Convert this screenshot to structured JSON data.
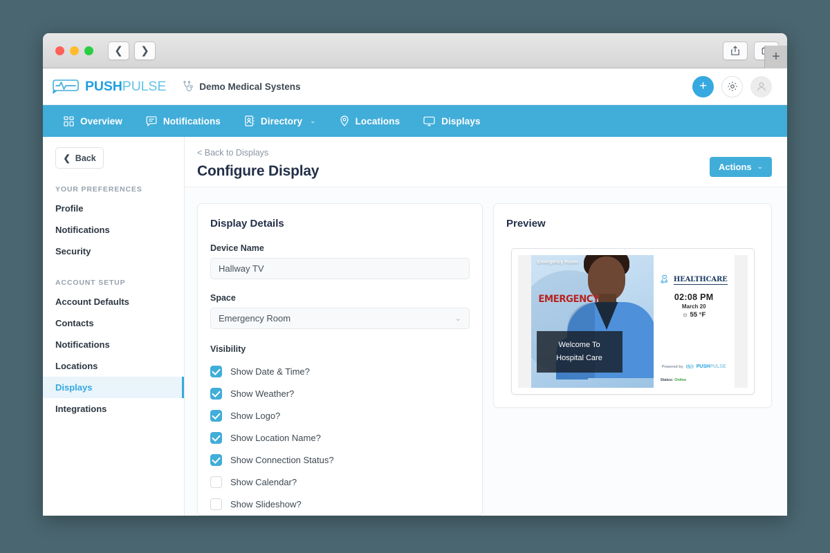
{
  "browser": {
    "back_icon": "chevron-left-icon",
    "forward_icon": "chevron-right-icon",
    "share_icon": "share-icon",
    "tabs_icon": "copy-tabs-icon",
    "new_tab_label": "+"
  },
  "header": {
    "logo_bold": "PUSH",
    "logo_light": "PULSE",
    "org_name": "Demo Medical Systens",
    "add_label": "+",
    "gear_icon": "gear-icon",
    "avatar_icon": "user-avatar-icon"
  },
  "nav": {
    "items": [
      {
        "label": "Overview",
        "icon": "grid-icon",
        "caret": ""
      },
      {
        "label": "Notifications",
        "icon": "chat-bubble-icon",
        "caret": ""
      },
      {
        "label": "Directory",
        "icon": "address-book-icon",
        "caret": "⌄"
      },
      {
        "label": "Locations",
        "icon": "map-pin-icon",
        "caret": ""
      },
      {
        "label": "Displays",
        "icon": "monitor-icon",
        "caret": ""
      }
    ]
  },
  "sidebar": {
    "back_label": "Back",
    "groups": [
      {
        "title": "YOUR PREFERENCES",
        "items": [
          {
            "label": "Profile",
            "active": false
          },
          {
            "label": "Notifications",
            "active": false
          },
          {
            "label": "Security",
            "active": false
          }
        ]
      },
      {
        "title": "ACCOUNT SETUP",
        "items": [
          {
            "label": "Account Defaults",
            "active": false
          },
          {
            "label": "Contacts",
            "active": false
          },
          {
            "label": "Notifications",
            "active": false
          },
          {
            "label": "Locations",
            "active": false
          },
          {
            "label": "Displays",
            "active": true
          },
          {
            "label": "Integrations",
            "active": false
          }
        ]
      }
    ]
  },
  "page": {
    "breadcrumb": "< Back to Displays",
    "title": "Configure Display",
    "actions_label": "Actions",
    "actions_caret": "⌄"
  },
  "details": {
    "card_title": "Display Details",
    "device_name_label": "Device Name",
    "device_name_value": "Hallway TV",
    "space_label": "Space",
    "space_value": "Emergency Room",
    "space_caret": "⌄",
    "visibility_label": "Visibility",
    "checkboxes": [
      {
        "label": "Show Date & Time?",
        "checked": true
      },
      {
        "label": "Show Weather?",
        "checked": true
      },
      {
        "label": "Show Logo?",
        "checked": true
      },
      {
        "label": "Show Location Name?",
        "checked": true
      },
      {
        "label": "Show Connection Status?",
        "checked": true
      },
      {
        "label": "Show Calendar?",
        "checked": false
      },
      {
        "label": "Show Slideshow?",
        "checked": false
      }
    ]
  },
  "preview": {
    "card_title": "Preview",
    "location_name": "Emergency Room",
    "emergency_sign": "EMERGENCY",
    "welcome_line1": "Welcome To",
    "welcome_line2": "Hospital Care",
    "brand_name": "HEALTHCARE",
    "brand_icon": "stethoscope-heart-icon",
    "time": "02:08 PM",
    "date": "March 20",
    "weather_icon": "☼",
    "temperature": "55 °F",
    "powered_by": "Powered by",
    "pp_bold": "PUSH",
    "pp_light": "PULSE",
    "status_label": "Status:",
    "status_value": "Online"
  },
  "colors": {
    "accent": "#41add9",
    "logo_blue": "#1f9fe0",
    "status_green": "#3f9c41",
    "desktop": "#4a6670"
  }
}
